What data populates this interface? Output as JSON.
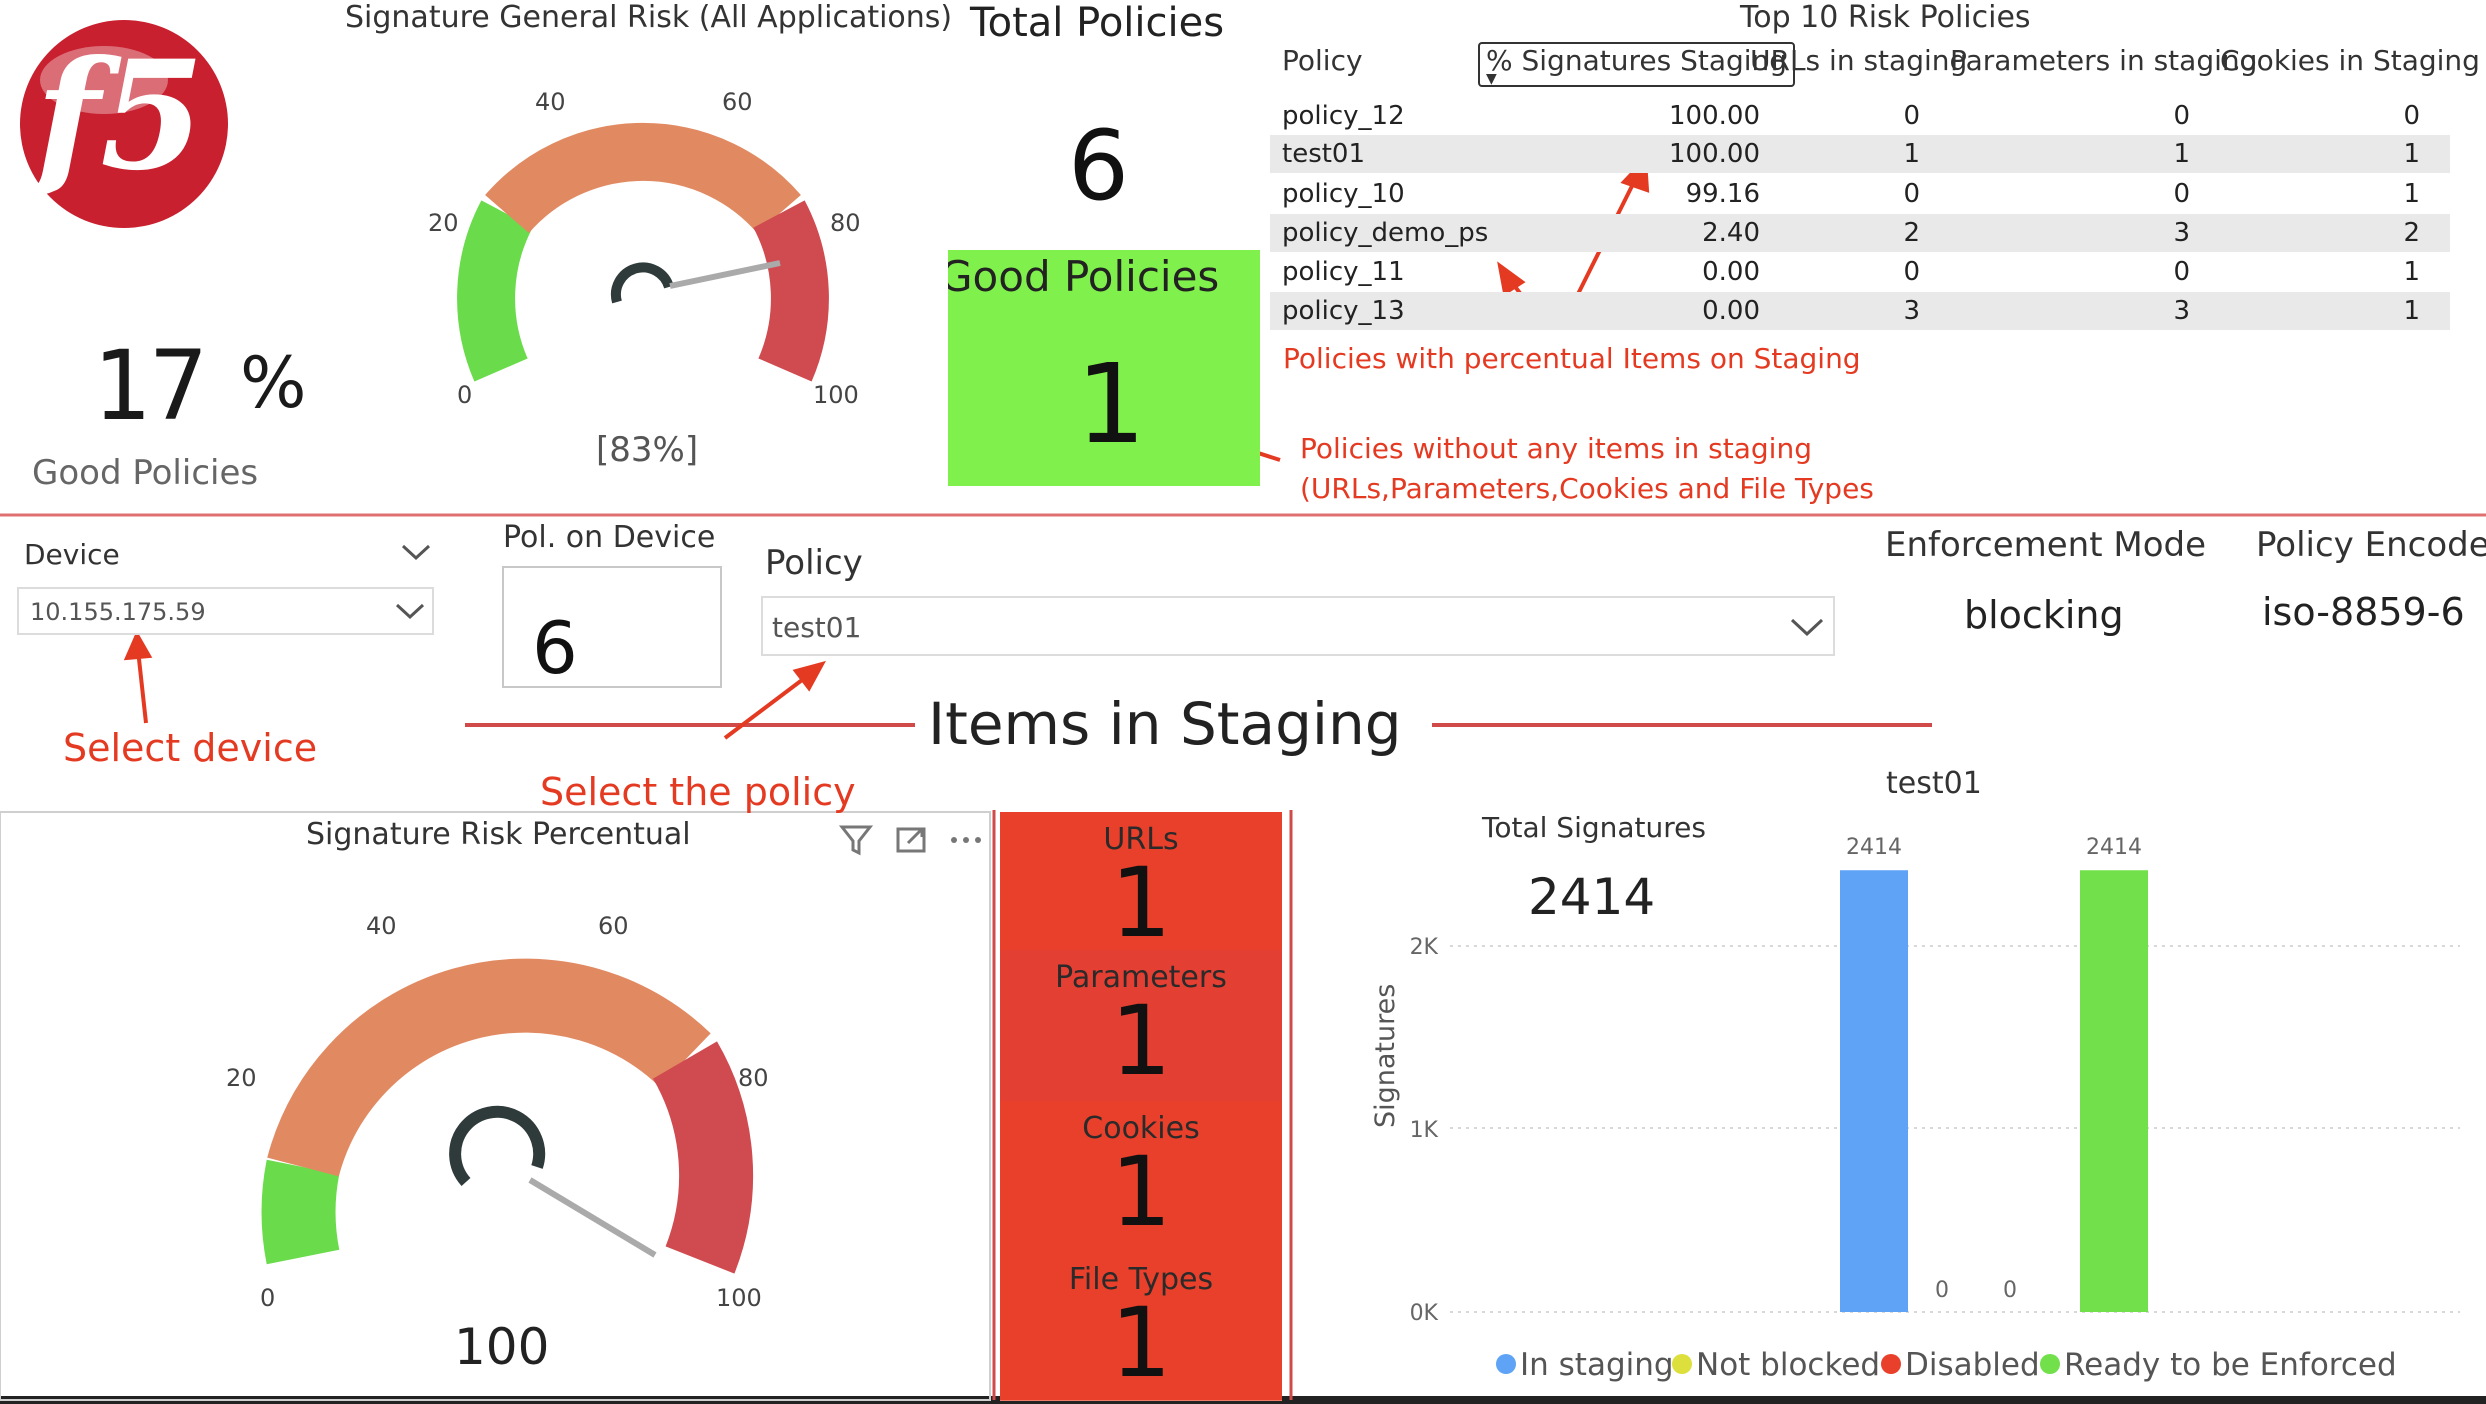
{
  "header": {
    "general_risk_title": "Signature General Risk (All Applications)",
    "total_policies_title": "Total Policies",
    "total_policies_value": "6",
    "top10_title": "Top 10 Risk Policies"
  },
  "kpi": {
    "good_percent_value": "17",
    "good_percent_sign": "%",
    "good_percent_label": "Good Policies"
  },
  "gauge_general": {
    "value": 83,
    "value_label": "[83%]",
    "ticks": [
      "0",
      "20",
      "40",
      "60",
      "80",
      "100"
    ]
  },
  "good_policies_tile": {
    "label": "Good Policies",
    "value": "1",
    "color": "#80f04c"
  },
  "top10_table": {
    "columns": [
      "Policy",
      "% Signatures Staging",
      "URLs in staging",
      "Parameters in staging",
      "Cookies in Staging"
    ],
    "rows": [
      {
        "policy": "policy_12",
        "sig": "100.00",
        "urls": "0",
        "params": "0",
        "cookies": "0"
      },
      {
        "policy": "test01",
        "sig": "100.00",
        "urls": "1",
        "params": "1",
        "cookies": "1"
      },
      {
        "policy": "policy_10",
        "sig": "99.16",
        "urls": "0",
        "params": "0",
        "cookies": "1"
      },
      {
        "policy": "policy_demo_ps",
        "sig": "2.40",
        "urls": "2",
        "params": "3",
        "cookies": "2"
      },
      {
        "policy": "policy_11",
        "sig": "0.00",
        "urls": "0",
        "params": "0",
        "cookies": "1"
      },
      {
        "policy": "policy_13",
        "sig": "0.00",
        "urls": "3",
        "params": "3",
        "cookies": "1"
      }
    ]
  },
  "annotations": {
    "staging_note": "Policies with percentual Items on Staging",
    "no_staging_line1": "Policies without any items in staging",
    "no_staging_line2": "(URLs,Parameters,Cookies and File Types",
    "select_device": "Select device",
    "select_policy": "Select the policy"
  },
  "filters": {
    "device_label": "Device",
    "device_value": "10.155.175.59",
    "pol_on_device_label": "Pol. on Device",
    "pol_on_device_value": "6",
    "policy_label": "Policy",
    "policy_value": "test01",
    "enforcement_label": "Enforcement Mode",
    "enforcement_value": "blocking",
    "encoding_label": "Policy Encode",
    "encoding_value": "iso-8859-6"
  },
  "section": {
    "title": "Items in Staging"
  },
  "risk_panel": {
    "title": "Signature Risk Percentual",
    "value": 100,
    "value_label": "100",
    "ticks": [
      "0",
      "20",
      "40",
      "60",
      "80",
      "100"
    ]
  },
  "staging_tiles": [
    {
      "label": "URLs",
      "value": "1"
    },
    {
      "label": "Parameters",
      "value": "1"
    },
    {
      "label": "Cookies",
      "value": "1"
    },
    {
      "label": "File Types",
      "value": "1"
    }
  ],
  "signatures": {
    "total_label": "Total Signatures",
    "total_value": "2414"
  },
  "chart_data": {
    "type": "bar",
    "title": "test01",
    "ylabel": "Signatures",
    "xlabel": "",
    "ylim": [
      0,
      2500
    ],
    "yticks": [
      "0K",
      "1K",
      "2K"
    ],
    "ytick_values": [
      0,
      1000,
      2000
    ],
    "series": [
      {
        "name": "In staging",
        "color": "#5ea3f5",
        "value": 2414,
        "label": "2414"
      },
      {
        "name": "Not blocked",
        "color": "#dde03c",
        "value": 0,
        "label": ""
      },
      {
        "name": "Disabled",
        "color": "#e8402a",
        "value": 0,
        "label": "0"
      },
      {
        "name": "Ready to be Enforced",
        "color": "#72e04a",
        "value": 2414,
        "label": "2414"
      }
    ],
    "zero_label": "0",
    "legend_position": "bottom",
    "grid": true
  }
}
